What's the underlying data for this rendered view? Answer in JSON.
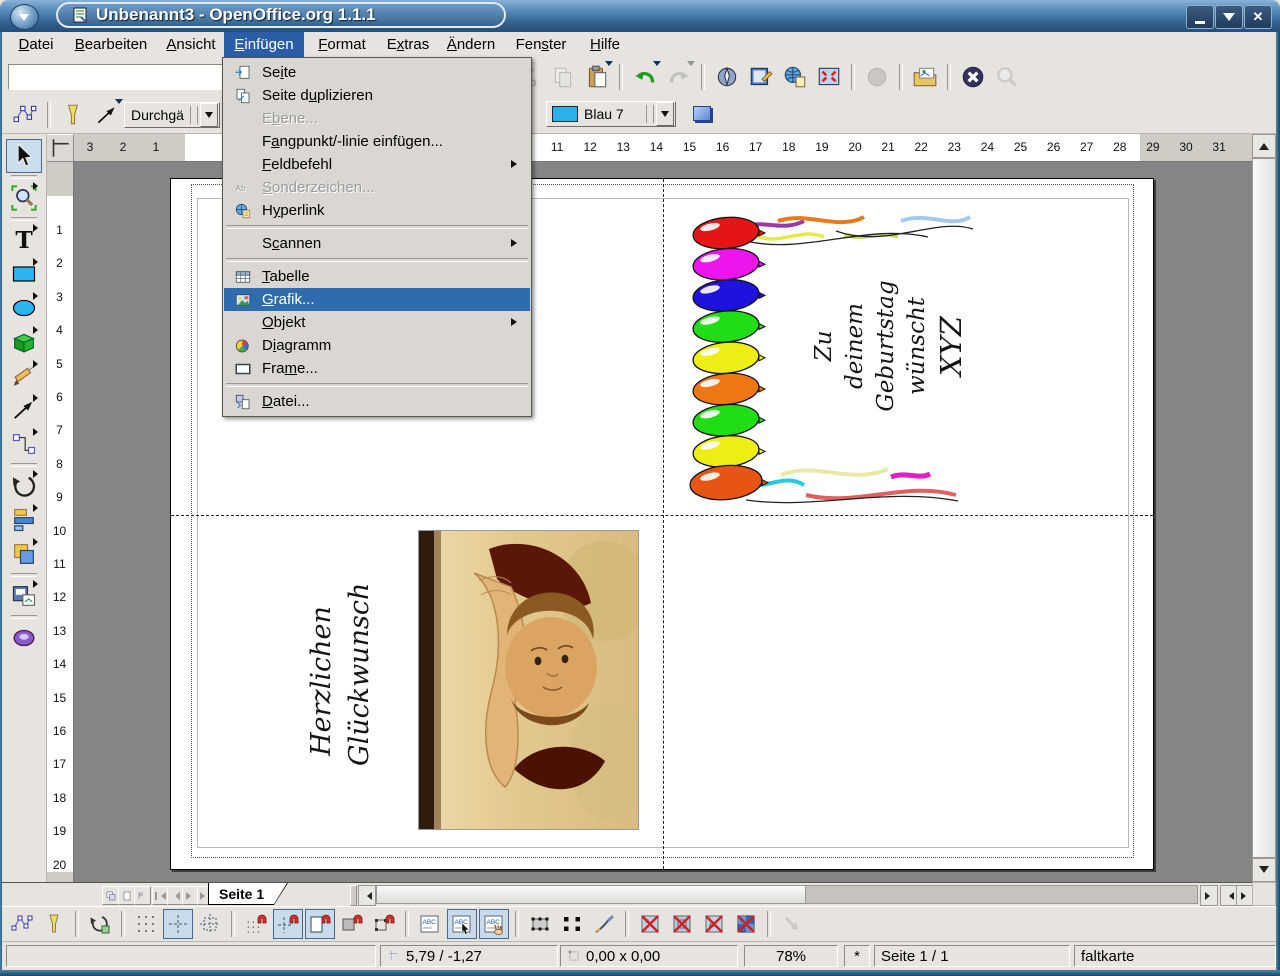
{
  "window": {
    "title": "Unbenannt3 - OpenOffice.org 1.1.1"
  },
  "menubar": [
    {
      "name": "datei",
      "pre": "",
      "accel": "D",
      "post": "atei"
    },
    {
      "name": "bearbeiten",
      "pre": "",
      "accel": "B",
      "post": "earbeiten"
    },
    {
      "name": "ansicht",
      "pre": "",
      "accel": "A",
      "post": "nsicht"
    },
    {
      "name": "einfuegen",
      "pre": "",
      "accel": "E",
      "post": "infügen",
      "active": true
    },
    {
      "name": "format",
      "pre": "",
      "accel": "F",
      "post": "ormat"
    },
    {
      "name": "extras",
      "pre": "E",
      "accel": "x",
      "post": "tras"
    },
    {
      "name": "aendern",
      "pre": "",
      "accel": "Ä",
      "post": "ndern"
    },
    {
      "name": "fenster",
      "pre": "Fen",
      "accel": "s",
      "post": "ter"
    },
    {
      "name": "hilfe",
      "pre": "",
      "accel": "H",
      "post": "ilfe"
    }
  ],
  "insert_menu": {
    "items": [
      {
        "name": "seite",
        "icon": "insert-page",
        "pre": "Se",
        "accel": "i",
        "post": "te"
      },
      {
        "name": "seite-duplizieren",
        "icon": "duplicate-page",
        "pre": "Seite d",
        "accel": "u",
        "post": "plizieren"
      },
      {
        "name": "ebene",
        "icon": "",
        "pre": "E",
        "accel": "b",
        "post": "ene...",
        "disabled": true
      },
      {
        "name": "fangpunkt-linie",
        "icon": "",
        "pre": "F",
        "accel": "a",
        "post": "ngpunkt/-linie einfügen..."
      },
      {
        "name": "feldbefehl",
        "icon": "",
        "pre": "",
        "accel": "F",
        "post": "eldbefehl",
        "submenu": true
      },
      {
        "name": "sonderzeichen",
        "icon": "special-char",
        "pre": "",
        "accel": "S",
        "post": "onderzeichen...",
        "disabled": true
      },
      {
        "name": "hyperlink",
        "icon": "hyperlink",
        "pre": "H",
        "accel": "y",
        "post": "perlink"
      },
      {
        "separator": true
      },
      {
        "name": "scannen",
        "icon": "",
        "pre": "S",
        "accel": "c",
        "post": "annen",
        "submenu": true
      },
      {
        "separator": true
      },
      {
        "name": "tabelle",
        "icon": "table",
        "pre": "",
        "accel": "T",
        "post": "abelle"
      },
      {
        "name": "grafik",
        "icon": "graphic",
        "pre": "",
        "accel": "G",
        "post": "rafik...",
        "selected": true
      },
      {
        "name": "objekt",
        "icon": "",
        "pre": "",
        "accel": "O",
        "post": "bjekt",
        "submenu": true
      },
      {
        "name": "diagramm",
        "icon": "chart",
        "pre": "D",
        "accel": "i",
        "post": "agramm"
      },
      {
        "name": "frame",
        "icon": "frame",
        "pre": "Fra",
        "accel": "m",
        "post": "e..."
      },
      {
        "separator": true
      },
      {
        "name": "datei",
        "icon": "insert-file",
        "pre": "",
        "accel": "D",
        "post": "atei..."
      }
    ]
  },
  "function_toolbar": {
    "url_value": "",
    "icons": [
      {
        "name": "print-file-icon",
        "icon": "printer"
      },
      {
        "separator": true
      },
      {
        "name": "cut-icon",
        "icon": "cut",
        "disabled": true
      },
      {
        "name": "copy-icon",
        "icon": "copy",
        "disabled": true
      },
      {
        "name": "paste-icon",
        "icon": "paste",
        "dropdown": true
      },
      {
        "separator": true
      },
      {
        "name": "undo-icon",
        "icon": "undo",
        "dropdown": true
      },
      {
        "name": "redo-icon",
        "icon": "redo",
        "disabled": true,
        "dropdown": true
      },
      {
        "separator": true
      },
      {
        "name": "navigator-icon",
        "icon": "navigator"
      },
      {
        "name": "stylist-icon",
        "icon": "stylist"
      },
      {
        "name": "hyperlink-dialog-icon",
        "icon": "hyperdlg"
      },
      {
        "name": "zoom-icon",
        "icon": "zoomscr"
      },
      {
        "separator": true
      },
      {
        "name": "record-macro-icon",
        "icon": "record",
        "disabled": true
      },
      {
        "separator": true
      },
      {
        "name": "gallery-icon",
        "icon": "gallery"
      },
      {
        "separator": true
      },
      {
        "name": "stop-icon",
        "icon": "stop"
      },
      {
        "name": "search-icon",
        "icon": "search",
        "disabled": true
      }
    ]
  },
  "object_bar": {
    "line_style_value": "Durchgä",
    "fill_color_value": "Blau 7",
    "fill_color_hex": "#29b1ea"
  },
  "drawing_toolbar": [
    {
      "name": "select-tool",
      "icon": "select",
      "pressed": true
    },
    {
      "separator": true
    },
    {
      "name": "zoom-tool",
      "icon": "zoomtool",
      "dropdown": true
    },
    {
      "separator": true
    },
    {
      "name": "text-tool",
      "icon": "texttool",
      "dropdown": true
    },
    {
      "name": "rectangle-tool",
      "icon": "recttool",
      "dropdown": true
    },
    {
      "name": "ellipse-tool",
      "icon": "ellipsetool",
      "dropdown": true
    },
    {
      "name": "objects3d-tool",
      "icon": "cube",
      "dropdown": true
    },
    {
      "name": "curve-tool",
      "icon": "curve",
      "dropdown": true
    },
    {
      "name": "lines-arrows-tool",
      "icon": "arrowline",
      "dropdown": true
    },
    {
      "name": "connector-tool",
      "icon": "connector",
      "dropdown": true
    },
    {
      "separator": true
    },
    {
      "name": "rotate-tool",
      "icon": "rotate",
      "dropdown": true
    },
    {
      "name": "alignment-tool",
      "icon": "align",
      "dropdown": true
    },
    {
      "name": "arrange-tool",
      "icon": "arrange",
      "dropdown": true
    },
    {
      "separator": true
    },
    {
      "name": "insert-object-tool",
      "icon": "insertobj",
      "dropdown": true
    },
    {
      "separator": true
    },
    {
      "name": "effects-tool",
      "icon": "effects"
    }
  ],
  "rulers": {
    "unit": "cm",
    "h_negative": [
      "3",
      "2",
      "1"
    ],
    "h_max": 32,
    "h_page_end": 28,
    "v_max": 20
  },
  "page": {
    "card_front_lines": [
      "Zu",
      "deinem",
      "Geburtstag",
      "wünscht",
      "XYZ"
    ],
    "card_inside_lines": [
      "Herzlichen",
      "Glückwunsch"
    ],
    "balloon_colors": [
      "#e61515",
      "#ee14ee",
      "#2012dd",
      "#20dd14",
      "#eeee14",
      "#ee7714",
      "#20dd14",
      "#eeee14",
      "#e65514"
    ]
  },
  "tab_bar": {
    "page_tab_label": "Seite 1"
  },
  "options_toolbar": [
    {
      "name": "edit-points-mode-icon",
      "icon": "editpoints"
    },
    {
      "name": "glue-points-mode-icon",
      "icon": "gluepoints"
    },
    {
      "separator": true
    },
    {
      "name": "rotation-mode-icon",
      "icon": "rotmode"
    },
    {
      "separator": true
    },
    {
      "name": "show-grid-icon",
      "icon": "grid"
    },
    {
      "name": "show-guides-icon",
      "icon": "guides",
      "pressed": true
    },
    {
      "name": "guides-when-moving-icon",
      "icon": "movegrid"
    },
    {
      "separator": true
    },
    {
      "name": "snap-to-grid-icon",
      "icon": "snapgrid"
    },
    {
      "name": "snap-to-guides-icon",
      "icon": "snapguides",
      "pressed": true
    },
    {
      "name": "snap-to-margins-icon",
      "icon": "snapmargin",
      "pressed": true
    },
    {
      "name": "snap-to-object-frame-icon",
      "icon": "snapframe"
    },
    {
      "name": "snap-to-object-points-icon",
      "icon": "snappoints"
    },
    {
      "separator": true
    },
    {
      "name": "quick-edit-icon",
      "icon": "quickedit"
    },
    {
      "name": "select-text-area-icon",
      "icon": "textarea",
      "pressed": true
    },
    {
      "name": "double-click-edit-text-icon",
      "icon": "dblclick",
      "pressed": true
    },
    {
      "separator": true
    },
    {
      "name": "modify-with-attributes-icon",
      "icon": "handlesblack"
    },
    {
      "name": "simple-handles-icon",
      "icon": "handlessimple"
    },
    {
      "name": "attributes-brush-icon",
      "icon": "brush"
    },
    {
      "separator": true
    },
    {
      "name": "picture-placeholder-icon",
      "icon": "crosspic"
    },
    {
      "name": "contour-mode-icon",
      "icon": "crosscontour"
    },
    {
      "name": "text-placeholder-icon",
      "icon": "crosstext"
    },
    {
      "name": "line-contour-icon",
      "icon": "crossall"
    },
    {
      "separator": true
    },
    {
      "name": "exit-group-icon",
      "icon": "greyarrow",
      "disabled": true
    }
  ],
  "statusbar": {
    "position": "5,79 / -1,27",
    "size": "0,00 x 0,00",
    "zoom": "78%",
    "modified": "*",
    "page": "Seite 1 / 1",
    "layout_name": "faltkarte"
  }
}
